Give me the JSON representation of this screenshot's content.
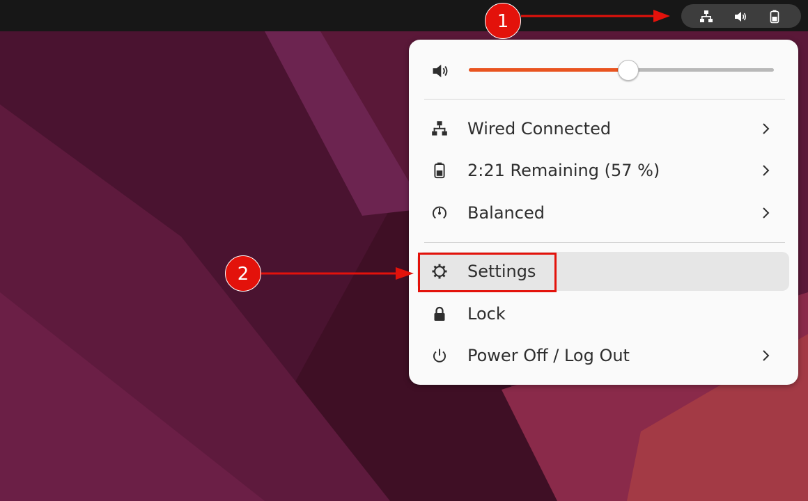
{
  "colors": {
    "accent": "#e95420",
    "annotation": "#e3120b",
    "menu_bg": "#fafafa",
    "topbar_bg": "#171717"
  },
  "tray": {
    "icons": [
      "network-wired-icon",
      "speaker-icon",
      "battery-icon"
    ]
  },
  "menu": {
    "volume": {
      "icon": "speaker-icon",
      "level_fraction": 0.52
    },
    "items": [
      {
        "label": "Wired Connected",
        "icon": "network-wired-icon",
        "chevron": true
      },
      {
        "label": "2:21 Remaining (57 %)",
        "icon": "battery-icon",
        "chevron": true
      },
      {
        "label": "Balanced",
        "icon": "power-profile-icon",
        "chevron": true
      },
      {
        "label": "Settings",
        "icon": "gear-icon",
        "chevron": false,
        "highlighted": true
      },
      {
        "label": "Lock",
        "icon": "lock-icon",
        "chevron": false
      },
      {
        "label": "Power Off / Log Out",
        "icon": "power-icon",
        "chevron": true
      }
    ]
  },
  "annotations": {
    "step1": "1",
    "step2": "2"
  }
}
